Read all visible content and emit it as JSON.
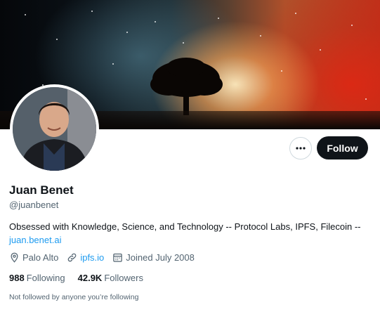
{
  "profile": {
    "name": "Juan Benet",
    "handle": "@juanbenet",
    "bio_text": "Obsessed with Knowledge, Science, and Technology -- Protocol Labs, IPFS, Filecoin -- ",
    "bio_link": "juan.benet.ai",
    "location": "Palo Alto",
    "website": "ipfs.io",
    "joined": "Joined July 2008"
  },
  "stats": {
    "following_count": "988",
    "following_label": "Following",
    "followers_count": "42.9K",
    "followers_label": "Followers"
  },
  "actions": {
    "follow_label": "Follow",
    "more_icon": "more-horizontal-icon"
  },
  "footer": {
    "not_followed": "Not followed by anyone you’re following"
  },
  "colors": {
    "accent": "#1d9bf0",
    "text_primary": "#0f1419",
    "text_secondary": "#536471",
    "button_dark": "#0f1419"
  }
}
